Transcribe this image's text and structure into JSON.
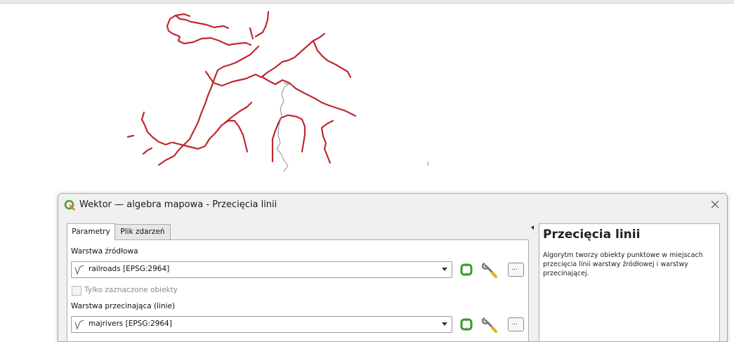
{
  "dialog": {
    "title": "Wektor — algebra mapowa - Przecięcia linii",
    "tabs": [
      "Parametry",
      "Plik zdarzeń"
    ],
    "source_layer": {
      "label": "Warstwa źródłowa",
      "value": "railroads [EPSG:2964]",
      "selected_only_label": "Tylko zaznaczone obiekty",
      "selected_only_checked": false
    },
    "intersect_layer": {
      "label": "Warstwa przecinająca (linie)",
      "value": "majrivers [EPSG:2964]"
    },
    "browse_label": "...",
    "help": {
      "title": "Przecięcia linii",
      "text": "Algorytm tworzy obiekty punktowe w miejscach przecięcia linii warstwy źródłowej i warstwy przecinającej."
    }
  },
  "map": {
    "river_color": "#c0282f",
    "railroad_color": "#8c8c8c"
  },
  "icons": {
    "app": "qgis-logo-icon",
    "close": "close-icon",
    "layer": "line-layer-icon",
    "iterate": "iterate-icon",
    "settings": "wrench-icon"
  }
}
